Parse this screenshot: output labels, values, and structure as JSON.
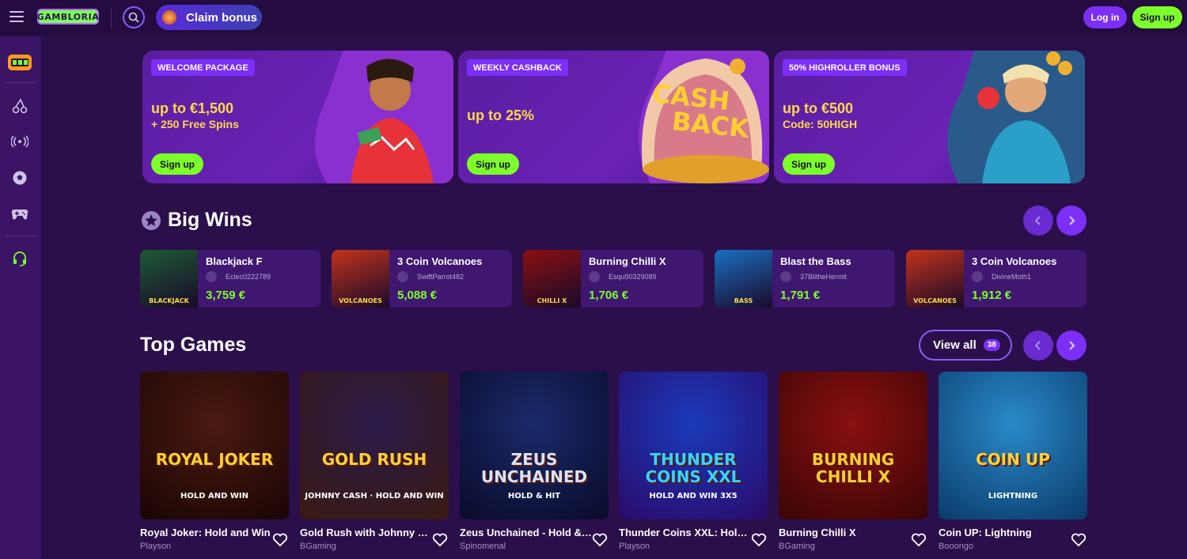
{
  "topbar": {
    "logo": "GAMBLORIA",
    "claim_bonus": "Claim bonus",
    "login": "Log in",
    "signup": "Sign up"
  },
  "sidebar": {
    "items": [
      "slot-machine-icon",
      "cherry-icon",
      "live-broadcast-icon",
      "soccer-ball-icon",
      "gamepad-icon",
      "headset-icon"
    ]
  },
  "promos": [
    {
      "tag": "WELCOME PACKAGE",
      "line1": "up to €1,500",
      "line2": "+ 250 Free Spins",
      "button": "Sign up"
    },
    {
      "tag": "WEEKLY CASHBACK",
      "line1": "up to 25%",
      "line2": "",
      "button": "Sign up",
      "art_text_1": "CASH",
      "art_text_2": "BACK"
    },
    {
      "tag": "50% HIGHROLLER BONUS",
      "line1": "up to €500",
      "line2": "Code: 50HIGH",
      "button": "Sign up"
    }
  ],
  "big_wins": {
    "title": "Big Wins",
    "items": [
      {
        "game": "Blackjack F",
        "user": "Eclec0222789",
        "amount": "3,759 €",
        "thumb_text": "BLACKJACK",
        "color": "#1d5a35"
      },
      {
        "game": "3 Coin Volcanoes",
        "user": "SwiftParrot482",
        "amount": "5,088 €",
        "thumb_text": "VOLCANOES",
        "color": "#c2331a"
      },
      {
        "game": "Burning Chilli X",
        "user": "Esqu90329089",
        "amount": "1,706 €",
        "thumb_text": "CHILLI X",
        "color": "#8a1010"
      },
      {
        "game": "Blast the Bass",
        "user": "37BlitheHermit",
        "amount": "1,791 €",
        "thumb_text": "BASS",
        "color": "#1a6fc2"
      },
      {
        "game": "3 Coin Volcanoes",
        "user": "DivineMoth1",
        "amount": "1,912 €",
        "thumb_text": "VOLCANOES",
        "color": "#c2331a"
      }
    ]
  },
  "top_games": {
    "title": "Top Games",
    "view_all": "View all",
    "count": "38",
    "items": [
      {
        "name": "Royal Joker: Hold and Win",
        "provider": "Playson",
        "art": "ROYAL JOKER",
        "art_sub": "HOLD AND WIN",
        "bg1": "#4a1a10",
        "bg2": "#1a0505",
        "fg": "#ffcf33"
      },
      {
        "name": "Gold Rush with Johnny Cash",
        "provider": "BGaming",
        "art": "GOLD RUSH",
        "art_sub": "JOHNNY CASH · HOLD AND WIN",
        "bg1": "#2a1a4a",
        "bg2": "#3a1a10",
        "fg": "#ffd03a"
      },
      {
        "name": "Zeus Unchained - Hold & Hit",
        "provider": "Spinomenal",
        "art": "ZEUS UNCHAINED",
        "art_sub": "HOLD & HIT",
        "bg1": "#1a2a6a",
        "bg2": "#0a0a2a",
        "fg": "#d8e4ff"
      },
      {
        "name": "Thunder Coins XXL: Hold and Win",
        "provider": "Playson",
        "art": "THUNDER COINS XXL",
        "art_sub": "HOLD AND WIN 3X5",
        "bg1": "#1a3aba",
        "bg2": "#2a0a6a",
        "fg": "#33d6ff"
      },
      {
        "name": "Burning Chilli X",
        "provider": "BGaming",
        "art": "BURNING CHILLI X",
        "art_sub": "",
        "bg1": "#8a1010",
        "bg2": "#3a0505",
        "fg": "#ffcf33"
      },
      {
        "name": "Coin UP: Lightning",
        "provider": "Booongo",
        "art": "COIN UP",
        "art_sub": "LIGHTNING",
        "bg1": "#2a8aca",
        "bg2": "#0a3a6a",
        "fg": "#ffd03a"
      }
    ]
  }
}
